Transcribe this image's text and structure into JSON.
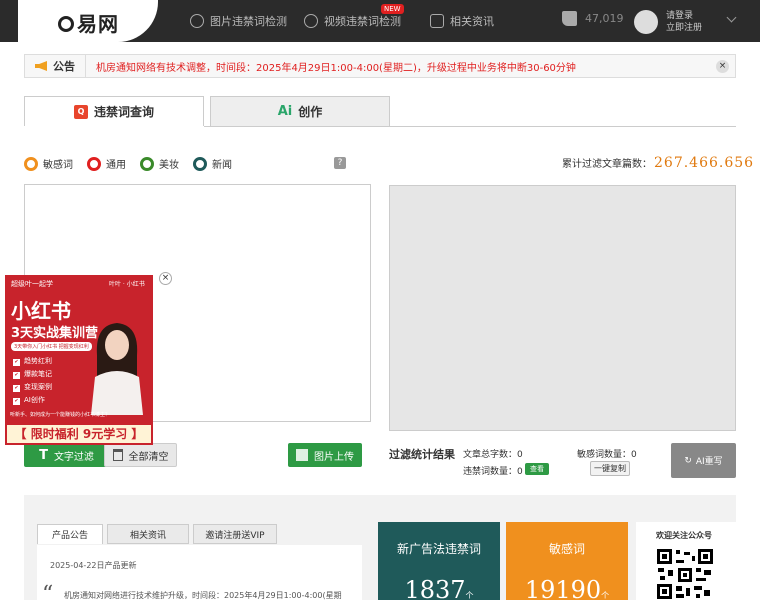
{
  "header": {
    "logo_text": "易网",
    "nav": [
      {
        "label": "图片违禁词检测",
        "icon": "image-scan-icon"
      },
      {
        "label": "视频违禁词检测",
        "icon": "video-scan-icon",
        "badge": "NEW"
      },
      {
        "label": "相关资讯",
        "icon": "news-icon"
      }
    ],
    "like_count": "47,019",
    "login_line1": "请登录",
    "login_line2": "立即注册"
  },
  "notice": {
    "label": "公告",
    "message": "机房通知网络有技术调整，时间段：2025年4月29日1:00-4:00(星期二)，升级过程中业务将中断30-60分钟",
    "close": "×"
  },
  "tabs": [
    {
      "label": "违禁词查询",
      "icon_text": "Q",
      "active": true
    },
    {
      "label": "创作",
      "icon_text": "Ai",
      "active": false
    }
  ],
  "categories": [
    {
      "label": "敏感词",
      "color": "#f0901e",
      "selected": true
    },
    {
      "label": "通用",
      "color": "#e02020",
      "selected": false
    },
    {
      "label": "美妆",
      "color": "#3a8a2a",
      "selected": false
    },
    {
      "label": "新闻",
      "color": "#1f5a5a",
      "selected": false
    }
  ],
  "help": "?",
  "total": {
    "label": "累计过滤文章篇数：",
    "value": "267.466.656"
  },
  "buttons": {
    "filter": "文字过滤",
    "clear": "全部清空",
    "upload": "图片上传",
    "view": "查看",
    "copy": "一键复制",
    "ai_rewrite": "AI重写"
  },
  "stats": {
    "title": "过滤统计结果",
    "total_words": "文章总字数：0",
    "banned_words": "违禁词数量：0",
    "sensitive_words": "敏感词数量：0"
  },
  "ad": {
    "top_left": "超级叶一起学",
    "top_right": "叶叶 · 小红书",
    "title": "小红书",
    "subtitle": "3天实战集训营",
    "banner": "3天带你入门小红书 把握变现红利",
    "list": [
      "趋势红利",
      "爆款笔记",
      "变现案例",
      "AI创作"
    ],
    "footer": "听新手、如何成为一个能赚钱的小红书博主？",
    "cta": "【 限时福利 9元学习 】",
    "close": "×"
  },
  "bottom": {
    "tabs": [
      "产品公告",
      "相关资讯",
      "邀请注册送VIP"
    ],
    "news_date": "2025-04-22日产品更新",
    "news_line": "机房通知对网络进行技术维护升级，时间段：2025年4月29日1:00-4:00(星期",
    "cards": [
      {
        "title": "新广告法违禁词",
        "value": "1837",
        "unit": "个",
        "color": "#1f5a5a"
      },
      {
        "title": "敏感词",
        "value": "19190",
        "unit": "个",
        "color": "#f0901e"
      }
    ],
    "qr_title": "欢迎关注公众号"
  }
}
